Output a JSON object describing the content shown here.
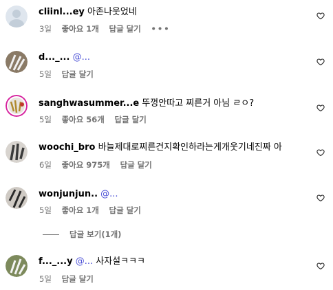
{
  "comments": [
    {
      "username": "cliinl...ey",
      "text": "아존나웃었네",
      "mention": "",
      "time": "3일",
      "likes": "좋아요 1개",
      "reply": "답글 달기",
      "more": "•••"
    },
    {
      "username": "d..._...",
      "text": "",
      "mention": "@...",
      "time": "5일",
      "likes": "",
      "reply": "답글 달기"
    },
    {
      "username": "sanghwasummer...e",
      "text": "뚜껑안따고 찌른거 아님 ㄹㅇ?",
      "mention": "",
      "time": "5일",
      "likes": "좋아요 56개",
      "reply": "답글 달기"
    },
    {
      "username": "woochi_bro",
      "text": "바늘제대로찌른건지확인하라는게개웃기네진짜 아",
      "mention": "",
      "time": "6일",
      "likes": "좋아요 975개",
      "reply": "답글 달기"
    },
    {
      "username": "wonjunjun..",
      "text": "",
      "mention": "@...",
      "time": "5일",
      "likes": "좋아요 1개",
      "reply": "답글 달기"
    },
    {
      "username": "f..._...y",
      "text": "사자설ㅋㅋㅋ",
      "mention": "@...",
      "time": "5일",
      "likes": "",
      "reply": "답글 달기"
    }
  ],
  "replies_toggle": "답글 보기(1개)",
  "icons": {
    "like": "heart-outline-icon",
    "more": "more-dots-icon"
  },
  "colors": {
    "meta": "#737373",
    "mention": "#4a4fd6"
  }
}
